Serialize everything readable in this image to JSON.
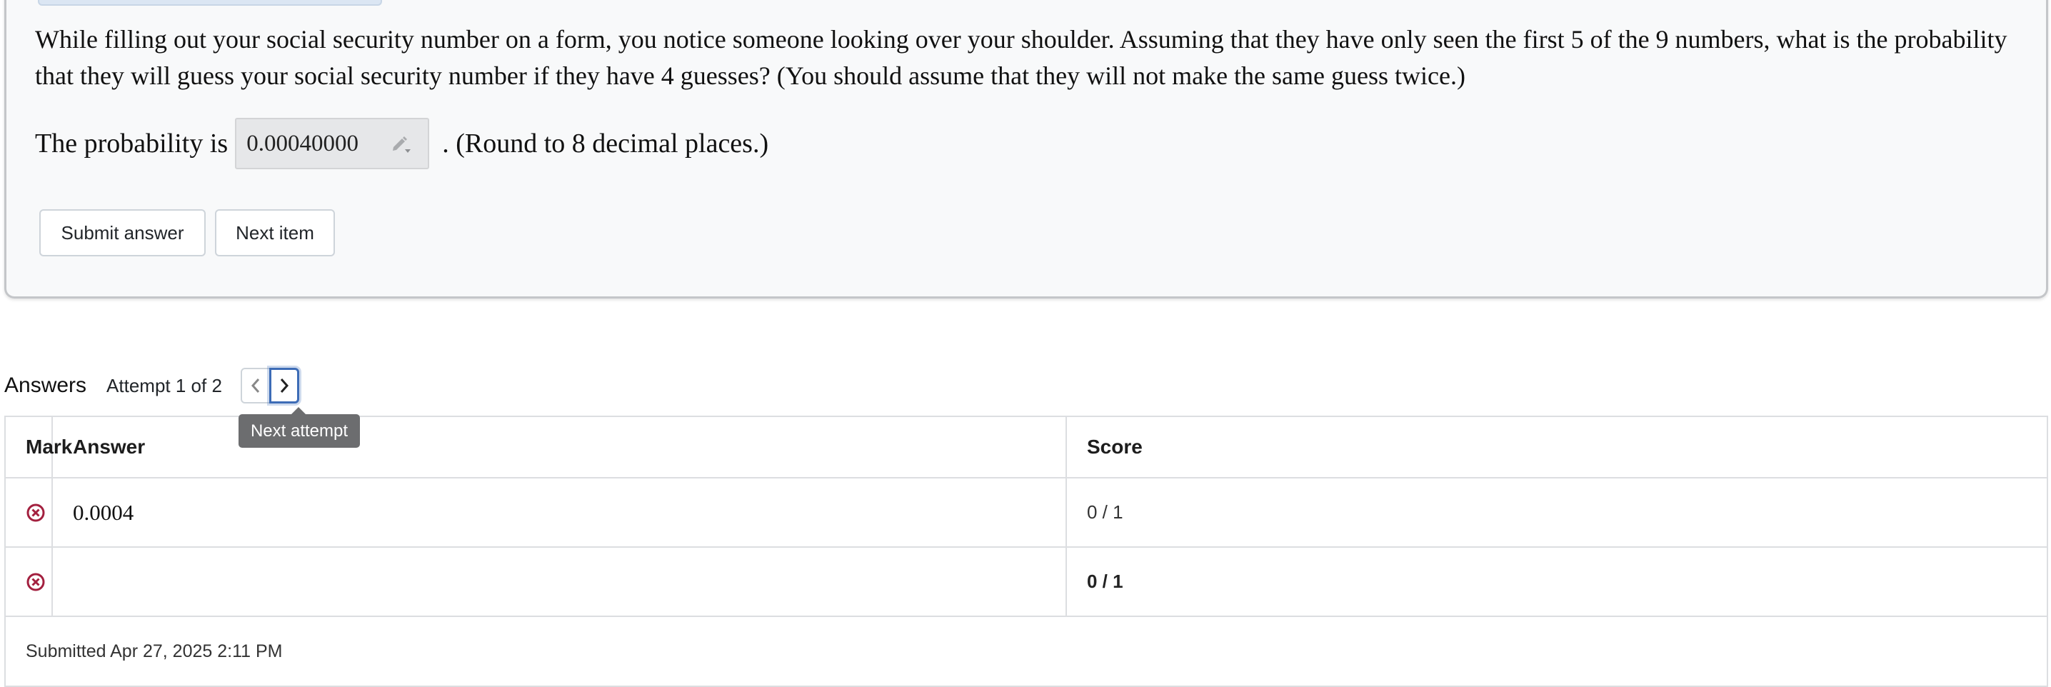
{
  "question": {
    "text": "While filling out your social security number on a form, you notice someone looking over your shoulder. Assuming that they have only seen the first 5 of the 9 numbers, what is the probability that they will guess your social security number if they have 4 guesses? (You should assume that they will not make the same guess twice.)",
    "prefix": "The probability is",
    "input_value": "0.00040000",
    "suffix": ". (Round to 8 decimal places.)",
    "input_icon": "pencil-dropdown-icon"
  },
  "buttons": {
    "submit_label": "Submit answer",
    "next_label": "Next item"
  },
  "answers": {
    "title": "Answers",
    "attempt_label": "Attempt 1 of 2",
    "prev_icon": "chevron-left-icon",
    "next_icon": "chevron-right-icon",
    "tooltip": "Next attempt",
    "columns": {
      "mark": "Mark",
      "answer": "Answer",
      "score": "Score"
    },
    "rows": [
      {
        "mark_icon": "incorrect-circle-x-icon",
        "answer": "0.0004",
        "score": "0 / 1"
      },
      {
        "mark_icon": "incorrect-circle-x-icon",
        "answer": "",
        "score": "0 / 1"
      }
    ],
    "submitted": "Submitted Apr 27, 2025 2:11 PM"
  },
  "colors": {
    "incorrect": "#a3203f",
    "focus_ring": "#3d6cb6",
    "tooltip_bg": "#6c6d6f"
  }
}
